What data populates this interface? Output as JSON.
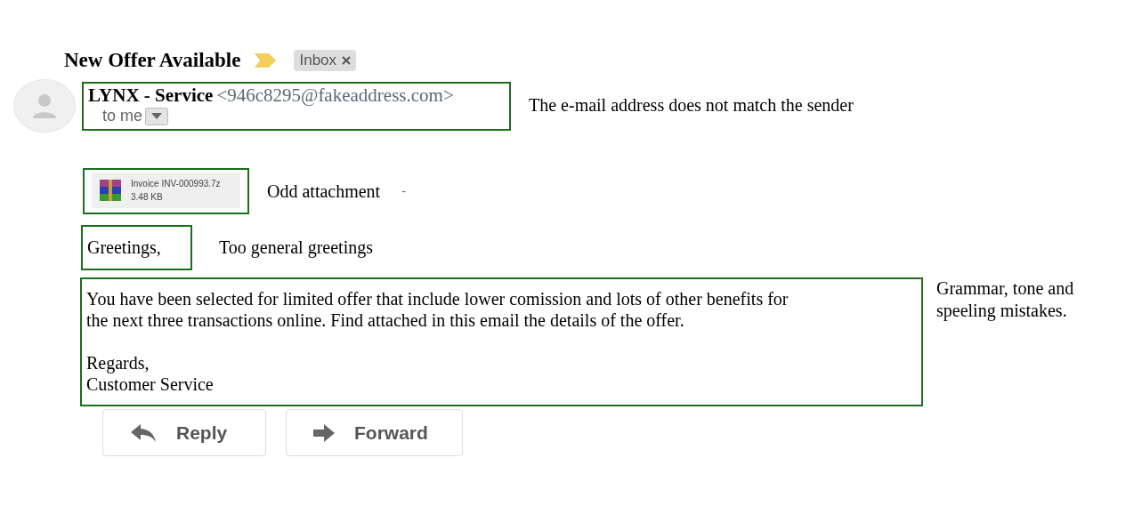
{
  "email": {
    "subject": "New Offer Available",
    "important": true,
    "label": "Inbox",
    "sender_name": "LYNX - Service",
    "sender_address": "<946c8295@fakeaddress.com>",
    "recipient": "to me",
    "attachment": {
      "name": "Invoice INV-000993.7z",
      "size": "3.48 KB"
    },
    "greeting": "Greetings,",
    "body": "You have been selected for limited offer that include lower comission and lots of other benefits for\nthe next three transactions online. Find attached in this email the details of the offer.",
    "signoff": [
      "Regards,",
      "Customer Service"
    ],
    "buttons": [
      {
        "kind": "reply",
        "label": "Reply"
      },
      {
        "kind": "forward",
        "label": "Forward"
      }
    ]
  },
  "annotations": {
    "sender": "The e-mail address does not match the sender",
    "attachment": "Odd attachment",
    "stray_mark": "-",
    "greeting": "Too general greetings",
    "body": "Grammar, tone and\nspeeling mistakes."
  }
}
